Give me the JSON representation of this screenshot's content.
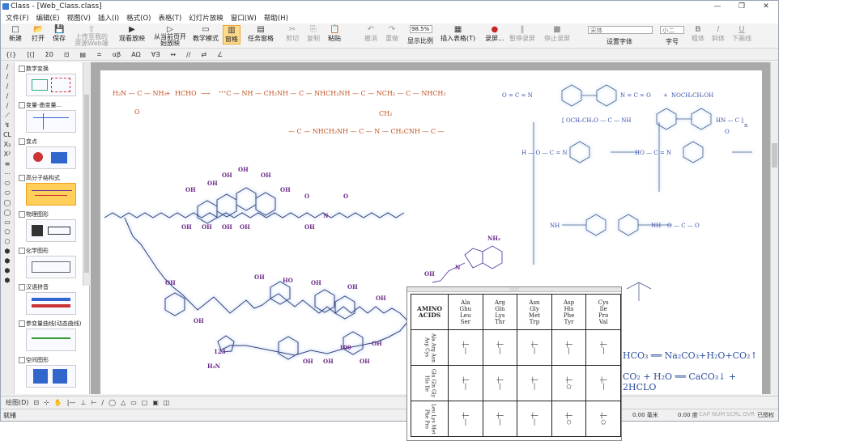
{
  "window": {
    "title": "Class - [Web_Class.class]",
    "controls": [
      "—",
      "❐",
      "✕"
    ]
  },
  "menu": [
    "文件(F)",
    "编辑(E)",
    "视图(V)",
    "插入(I)",
    "格式(O)",
    "表格(T)",
    "幻灯片放映",
    "窗口(W)",
    "帮助(H)"
  ],
  "ribbon": {
    "buttons": [
      {
        "label": "新建",
        "icon": "□",
        "state": "normal"
      },
      {
        "label": "打开",
        "icon": "📂",
        "state": "normal"
      },
      {
        "label": "保存",
        "icon": "💾",
        "state": "normal"
      },
      {
        "label": "上传至我的资源Web端",
        "icon": "⇧",
        "state": "disabled"
      },
      {
        "label": "观看放映",
        "icon": "▶",
        "state": "normal"
      },
      {
        "label": "从当前页开始放映",
        "icon": "▷",
        "state": "normal"
      },
      {
        "label": "教学模式",
        "icon": "▭",
        "state": "normal"
      },
      {
        "label": "窗格",
        "icon": "▥",
        "state": "selected"
      },
      {
        "label": "任务窗格",
        "icon": "▤",
        "state": "normal"
      },
      {
        "label": "剪切",
        "icon": "✂",
        "state": "disabled"
      },
      {
        "label": "复制",
        "icon": "⎘",
        "state": "disabled"
      },
      {
        "label": "粘贴",
        "icon": "📋",
        "state": "normal"
      },
      {
        "label": "撤消",
        "icon": "↶",
        "state": "disabled"
      },
      {
        "label": "重做",
        "icon": "↷",
        "state": "disabled"
      },
      {
        "label": "插入表格(T)",
        "icon": "▦",
        "state": "normal"
      },
      {
        "label": "录屏...",
        "icon": "●",
        "state": "normal"
      },
      {
        "label": "暂停录屏",
        "icon": "‖",
        "state": "disabled"
      },
      {
        "label": "停止录屏",
        "icon": "■",
        "state": "disabled"
      },
      {
        "label": "粗体",
        "icon": "B",
        "state": "disabled"
      },
      {
        "label": "斜体",
        "icon": "I",
        "state": "disabled"
      },
      {
        "label": "下画线",
        "icon": "U",
        "state": "disabled"
      }
    ],
    "zoom_value": "98.5%",
    "zoom_label": "显示比例",
    "font_value": "宋体",
    "font_label": "设置字体",
    "size_value": "小二",
    "size_label": "字号"
  },
  "toolbar2": [
    "{(}",
    "[(]",
    "Σ0",
    "⊡",
    "▤",
    "≐",
    "αβ",
    "ΑΩ",
    "∀∃",
    "↔",
    "∕∕",
    "⇄",
    "∠"
  ],
  "lefttools": [
    "∕",
    "∕",
    "∕",
    "∕",
    "∕",
    "⟋",
    "↯",
    "CL",
    "X₂",
    "X²",
    "≡",
    "⋯",
    "⬭",
    "⬭",
    "◯",
    "◯",
    "▭",
    "⬠",
    "⬡",
    "⬢",
    "⬢",
    "⬢",
    "⬢"
  ],
  "panel": {
    "categories": [
      {
        "label": "数学变换",
        "selected": false
      },
      {
        "label": "变量-曲变量...",
        "selected": false
      },
      {
        "label": "变点",
        "selected": false
      },
      {
        "label": "高分子结构式",
        "selected": true
      },
      {
        "label": "物理图形",
        "selected": false
      },
      {
        "label": "化学图形",
        "selected": false
      },
      {
        "label": "汉语拼音",
        "selected": false
      },
      {
        "label": "参变量曲线(动态曲线)",
        "selected": false
      },
      {
        "label": "空间图形",
        "selected": false
      }
    ]
  },
  "chemistry": {
    "reaction1": {
      "reactant": "H₂N — C — NH₂",
      "plus": "+",
      "reagent": "HCHO",
      "arrow": "⟶",
      "product": "ᐩᐩᐩC — NH — CH₂NH — C — NHCH₂NH — C — NCH₂ — C — NHCH₂",
      "product2": "— C — NHCH₂NH — C — N — CH₂CNH — C —",
      "o_label": "O",
      "ch2": "CH₂"
    },
    "reaction2": {
      "left": "O = C = N",
      "mid": "N = C = O",
      "plus": "+",
      "reagent": "NOCH₂CH₂OH",
      "polymer": "[ OCH₂CH₂O — C — NH",
      "hn": "HN — C ]",
      "n": "n",
      "o": "O",
      "ho": "HO — C = N",
      "hoc": "H — O — C = N",
      "nh": "NH",
      "oc": "O — C — O"
    },
    "amino": {
      "header": "AMINO ACIDS",
      "cols": [
        "Ala\nGhu\nLeu\nSer",
        "Arg\nGln\nLys\nThr",
        "Asn\nGly\nMet\nTrp",
        "Asp\nHis\nPhe\nTyr",
        "Cys\nIle\nPro\nVal"
      ],
      "rows": [
        "Ala Arg Asn Asp Cys",
        "Glu Gln Gly His Ile",
        "Leu Lys Met Phe Pro"
      ]
    },
    "formulas": [
      "HCO₃ ══ Na₂CO₃+H₂O+CO₂↑",
      "CO₂ + H₂O ══ CaCO₃↓ + 2HCLO"
    ],
    "adenine": "NH₂",
    "labels": {
      "oh": "OH",
      "ho": "HO",
      "n": "N",
      "o": "O",
      "h2n": "H₂N",
      "n123": "123",
      "n100": "100"
    }
  },
  "drawbar": [
    "绘图(D)",
    "⊡",
    "⊹",
    "✋",
    "|—",
    "⊥",
    "⊢",
    "∕",
    "◯",
    "△",
    "▭",
    "▢",
    "▣",
    "◫"
  ],
  "status": {
    "ready": "就绪",
    "unit": "0.00 毫米",
    "angle": "0.00 度",
    "flags": [
      "CAP",
      "NUM",
      "SCRL",
      "OVR"
    ],
    "mode": "已授权"
  }
}
